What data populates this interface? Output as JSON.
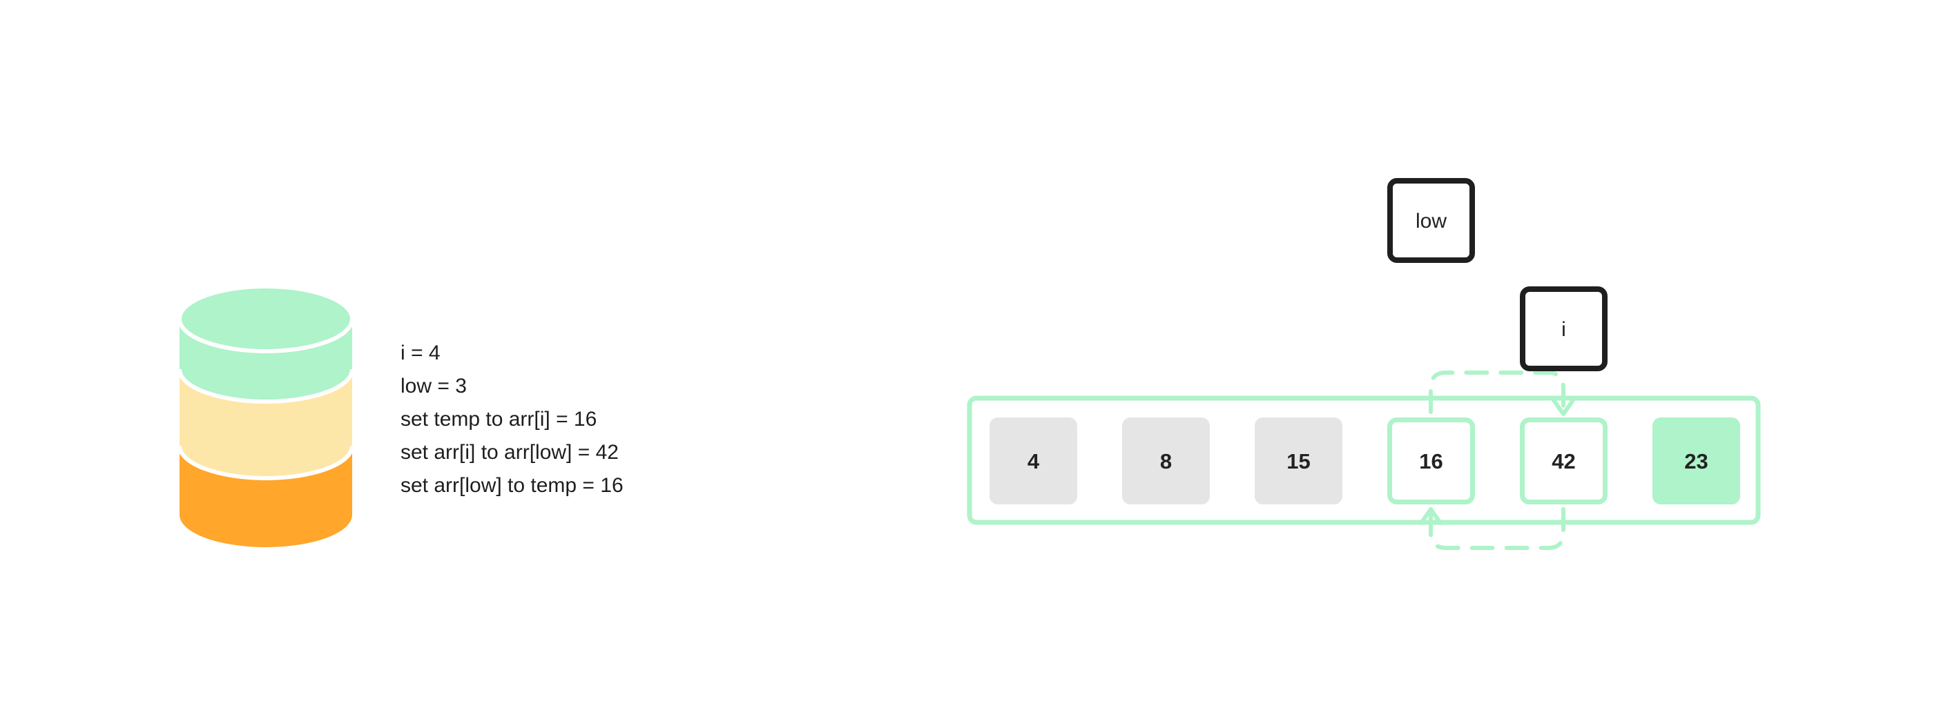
{
  "stack": {
    "layers": [
      {
        "color": "#AEF3C9"
      },
      {
        "color": "#FDE7A8"
      },
      {
        "color": "#FFA62B"
      }
    ]
  },
  "variables": [
    "i = 4",
    "low = 3",
    "set temp to arr[i] = 16",
    "set arr[i] to arr[low] = 42",
    "set arr[low] to temp = 16"
  ],
  "array": {
    "values": [
      "4",
      "8",
      "15",
      "16",
      "42",
      "23"
    ],
    "states": [
      "sorted",
      "sorted",
      "sorted",
      "swap",
      "swap",
      "current"
    ],
    "border_color": "#AEF3C9"
  },
  "pointers": {
    "low": {
      "label": "low",
      "index": 3
    },
    "i": {
      "label": "i",
      "index": 4
    }
  },
  "colors": {
    "sorted": "#E5E5E5",
    "swap_border": "#AEF3C9",
    "current": "#AEF3C9",
    "pointer_border": "#1F1F1F",
    "text": "#222222"
  }
}
